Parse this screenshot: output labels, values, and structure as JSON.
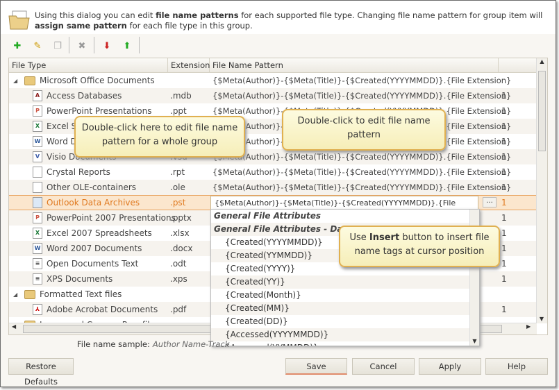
{
  "header": {
    "desc_1": "Using this dialog you can edit ",
    "desc_b1": "file name patterns",
    "desc_2": " for each supported file type. Changing file name pattern for group item will ",
    "desc_b2": "assign same pattern",
    "desc_3": " for each file type in this group."
  },
  "toolbar": [
    "add-icon",
    "edit-icon",
    "copy-icon",
    "delete-icon",
    "move-down-icon",
    "move-up-icon"
  ],
  "columns": [
    "File Type",
    "Extension",
    "File Name Pattern",
    ""
  ],
  "pattern": "{$Meta(Author)}-{$Meta(Title)}-{$Created(YYYYMMDD)}.{File Extension}",
  "rows": [
    {
      "name": "Microsoft Office Documents",
      "group": true,
      "ext": "",
      "count": ""
    },
    {
      "name": "Access Databases",
      "ext": ".mdb",
      "count": "1",
      "icon": "access-icon"
    },
    {
      "name": "PowerPoint Presentations",
      "ext": ".ppt",
      "count": "1",
      "icon": "powerpoint-icon"
    },
    {
      "name": "Excel S",
      "ext": "",
      "count": "1",
      "icon": "excel-icon"
    },
    {
      "name": "Word D",
      "ext": "",
      "count": "1",
      "icon": "word-icon"
    },
    {
      "name": "Visio Documents",
      "ext": ".vsd",
      "count": "1",
      "icon": "visio-icon"
    },
    {
      "name": "Crystal Reports",
      "ext": ".rpt",
      "count": "1",
      "icon": "file-icon"
    },
    {
      "name": "Other OLE-containers",
      "ext": ".ole",
      "count": "1",
      "icon": "file-icon"
    },
    {
      "name": "Outlook Data Archives",
      "ext": ".pst",
      "count": "1",
      "icon": "file-icon",
      "selected": true
    },
    {
      "name": "PowerPoint 2007 Presentations",
      "ext": ".pptx",
      "count": "1",
      "icon": "powerpoint-icon"
    },
    {
      "name": "Excel 2007 Spreadsheets",
      "ext": ".xlsx",
      "count": "1",
      "icon": "excel-icon"
    },
    {
      "name": "Word 2007 Documents",
      "ext": ".docx",
      "count": "1",
      "icon": "word-icon"
    },
    {
      "name": "Open Documents Text",
      "ext": ".odt",
      "count": "1",
      "icon": "document-icon"
    },
    {
      "name": "XPS Documents",
      "ext": ".xps",
      "count": "1",
      "icon": "document-icon"
    },
    {
      "name": "Formatted Text files",
      "group": true,
      "ext": "",
      "count": ""
    },
    {
      "name": "Adobe Acrobat Documents",
      "ext": ".pdf",
      "count": "1",
      "icon": "pdf-icon"
    },
    {
      "name": "Image and Camera Raw files",
      "group": true,
      "ext": "",
      "count": ""
    }
  ],
  "dropdown": {
    "categories": [
      "General File Attributes",
      "General File Attributes - Dates"
    ],
    "items": [
      "{Created(YYYYMMDD)}",
      "{Created(YYMMDD)}",
      "{Created(YYYY)}",
      "{Created(YY)}",
      "{Created(Month)}",
      "{Created(MM)}",
      "{Created(DD)}",
      "{Accessed(YYYYMMDD)}",
      "{Accessed(YYMMDD)}"
    ]
  },
  "insert_button": "...",
  "callouts": {
    "group": "Double-click here to edit file name pattern for a whole group",
    "edit": "Double-click to edit file name pattern",
    "insert_1": "Use ",
    "insert_b": "Insert",
    "insert_2": " button to insert file name tags at cursor position"
  },
  "sample": {
    "label": "File name sample:",
    "value": "Author Name-Track"
  },
  "buttons": {
    "restore": "Restore Defaults",
    "save": "Save",
    "cancel": "Cancel",
    "apply": "Apply",
    "help": "Help"
  },
  "colors": {
    "accent": "#e07a20",
    "callout": "#f6eeb8"
  }
}
